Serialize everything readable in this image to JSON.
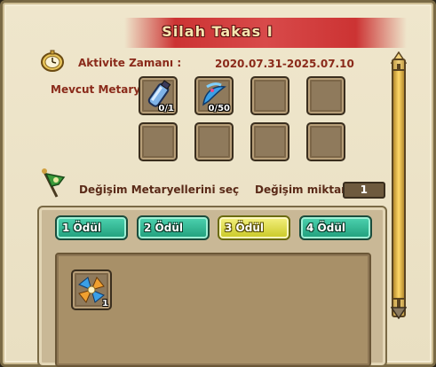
{
  "window": {
    "title": "Silah Takas I"
  },
  "activity": {
    "label": "Aktivite Zamanı :",
    "dates": "2020.07.31-2025.07.10"
  },
  "materials": {
    "label": "Mevcut Metary",
    "slots": [
      {
        "icon": "bottle-icon",
        "count": "0/1"
      },
      {
        "icon": "blue-feather-icon",
        "count": "0/50"
      }
    ]
  },
  "exchange": {
    "label": "Değişim Metaryellerini seç",
    "amount_label": "Değişim miktar",
    "amount_value": "1"
  },
  "tabs": [
    {
      "label": "1 Ödül"
    },
    {
      "label": "2 Ödül"
    },
    {
      "label": "3 Ödül",
      "active": true
    },
    {
      "label": "4 Ödül"
    }
  ],
  "reward": {
    "icon": "pinwheel-icon",
    "count": "1"
  }
}
